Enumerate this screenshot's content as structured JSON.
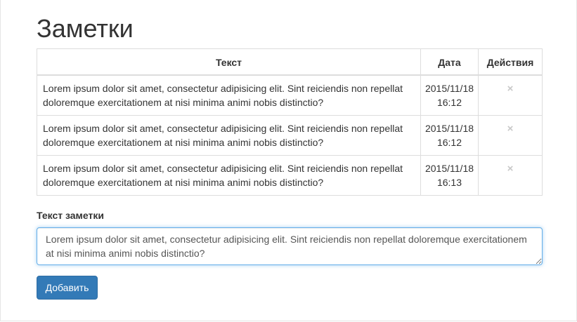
{
  "page": {
    "title": "Заметки"
  },
  "table": {
    "headers": [
      "Текст",
      "Дата",
      "Действия"
    ],
    "rows": [
      {
        "text": "Lorem ipsum dolor sit amet, consectetur adipisicing elit. Sint reiciendis non repellat doloremque exercitationem at nisi minima animi nobis distinctio?",
        "date": "2015/11/18",
        "time": "16:12",
        "action_icon": "×"
      },
      {
        "text": "Lorem ipsum dolor sit amet, consectetur adipisicing elit. Sint reiciendis non repellat doloremque exercitationem at nisi minima animi nobis distinctio?",
        "date": "2015/11/18",
        "time": "16:12",
        "action_icon": "×"
      },
      {
        "text": "Lorem ipsum dolor sit amet, consectetur adipisicing elit. Sint reiciendis non repellat doloremque exercitationem at nisi minima animi nobis distinctio?",
        "date": "2015/11/18",
        "time": "16:13",
        "action_icon": "×"
      }
    ]
  },
  "form": {
    "label": "Текст заметки",
    "textarea_value": "Lorem ipsum dolor sit amet, consectetur adipisicing elit. Sint reiciendis non repellat doloremque exercitationem at nisi minima animi nobis distinctio?",
    "submit_label": "Добавить"
  },
  "colors": {
    "primary_button": "#337ab7",
    "focus_border": "#66afe9",
    "table_border": "#dddddd",
    "close_icon": "#c8c8c8"
  },
  "icons": {
    "delete": "close-icon"
  }
}
